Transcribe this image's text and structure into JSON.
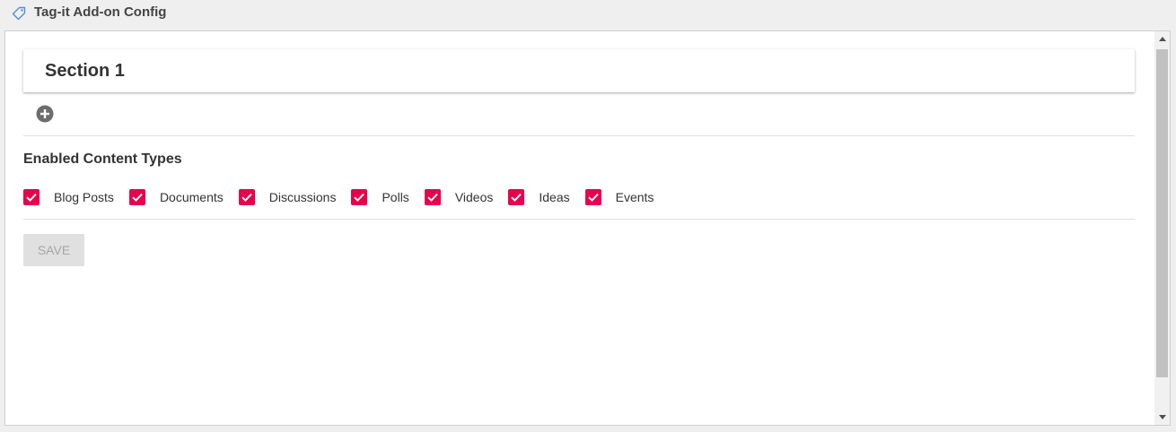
{
  "header": {
    "title": "Tag-it Add-on Config",
    "icon": "tag-icon"
  },
  "section": {
    "title": "Section 1",
    "add_icon": "plus-circle-icon"
  },
  "content_types": {
    "label": "Enabled Content Types",
    "items": [
      {
        "label": "Blog Posts",
        "checked": true
      },
      {
        "label": "Documents",
        "checked": true
      },
      {
        "label": "Discussions",
        "checked": true
      },
      {
        "label": "Polls",
        "checked": true
      },
      {
        "label": "Videos",
        "checked": true
      },
      {
        "label": "Ideas",
        "checked": true
      },
      {
        "label": "Events",
        "checked": true
      }
    ]
  },
  "actions": {
    "save_label": "SAVE",
    "save_disabled": true
  },
  "colors": {
    "checkbox": "#e8004c",
    "tag_icon": "#4a90d9",
    "add_icon": "#6d6d6d"
  }
}
